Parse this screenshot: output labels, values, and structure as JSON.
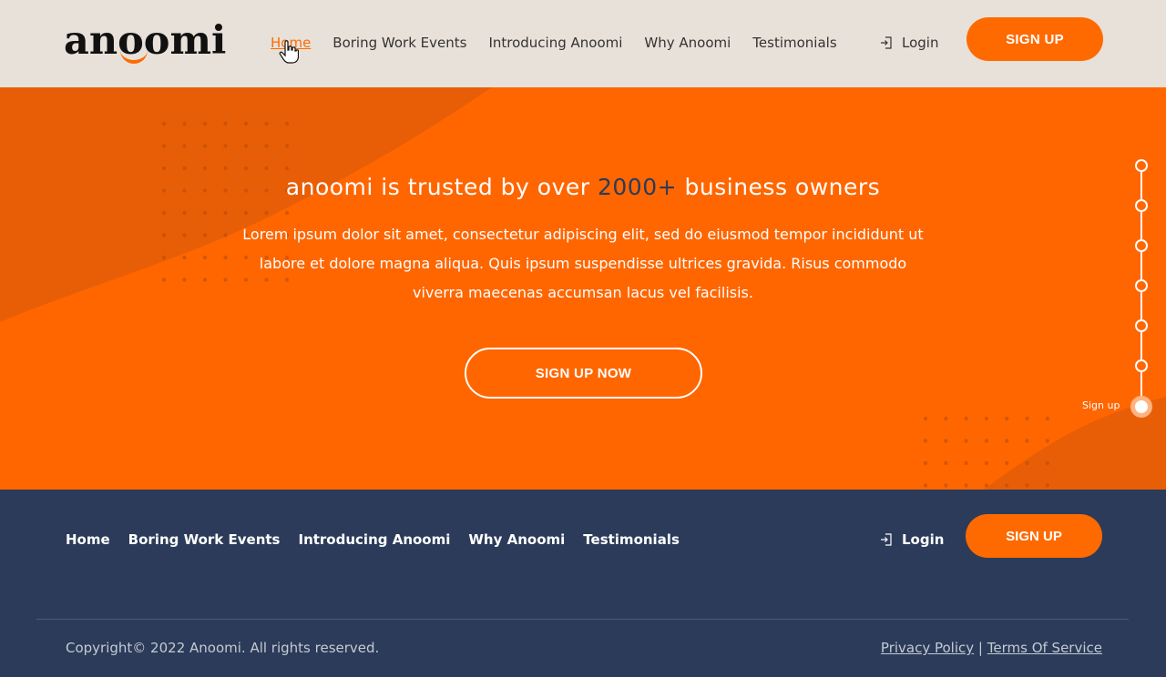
{
  "header": {
    "logo_text": "anoomi",
    "nav": [
      {
        "label": "Home",
        "active": true
      },
      {
        "label": "Boring Work Events",
        "active": false
      },
      {
        "label": "Introducing Anoomi",
        "active": false
      },
      {
        "label": "Why Anoomi",
        "active": false
      },
      {
        "label": "Testimonials",
        "active": false
      }
    ],
    "login_label": "Login",
    "signup_label": "SIGN UP"
  },
  "hero": {
    "title_pre": "anoomi is trusted by over ",
    "title_highlight": "2000+",
    "title_post": " business owners",
    "body": "Lorem ipsum dolor sit amet, consectetur adipiscing elit, sed do eiusmod tempor incididunt ut labore et dolore magna aliqua. Quis ipsum suspendisse ultrices gravida. Risus commodo viverra maecenas accumsan lacus vel facilisis.",
    "cta_label": "SIGN UP  NOW",
    "stepper_label": "Sign up"
  },
  "footer": {
    "nav": [
      {
        "label": "Home"
      },
      {
        "label": "Boring Work Events"
      },
      {
        "label": "Introducing Anoomi"
      },
      {
        "label": "Why Anoomi"
      },
      {
        "label": "Testimonials"
      }
    ],
    "login_label": "Login",
    "signup_label": "SIGN UP",
    "copyright": "Copyright© 2022 Anoomi. All rights reserved.",
    "privacy_label": "Privacy Policy",
    "separator": "|",
    "terms_label": "Terms Of Service"
  },
  "colors": {
    "brand_orange": "#ff6600",
    "header_bg": "#e8e1d9",
    "footer_bg": "#2b3b59"
  }
}
